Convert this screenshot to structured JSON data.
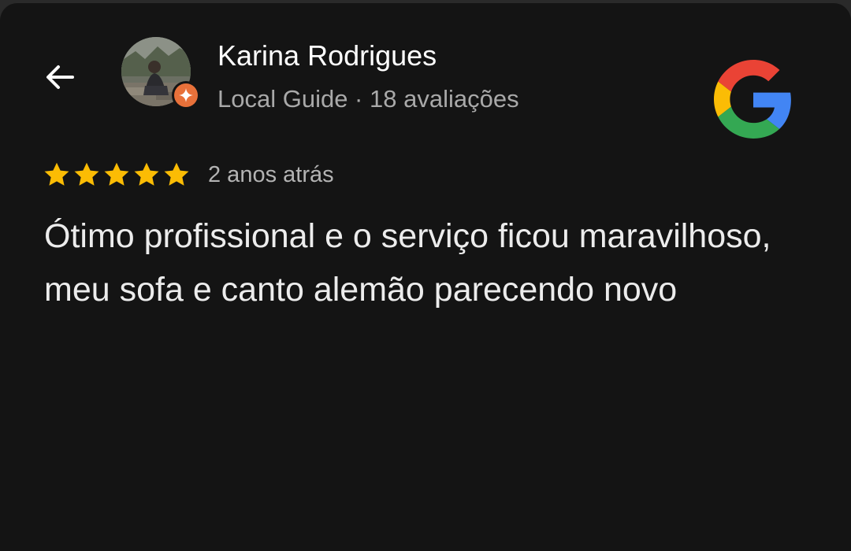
{
  "header": {
    "back_icon": "arrow-left-icon",
    "reviewer_name": "Karina Rodrigues",
    "reviewer_meta": "Local Guide · 18 avaliações",
    "badge_icon": "local-guide-star-icon",
    "brand_icon": "google-g-logo"
  },
  "review": {
    "rating": 5,
    "max_rating": 5,
    "star_color": "#fbbc04",
    "date": "2 anos atrás",
    "text": "Ótimo profissional e o serviço ficou maravilhoso, meu sofa e canto alemão parecendo novo"
  },
  "colors": {
    "background": "#141414",
    "badge": "#e8713a",
    "google_red": "#ea4335",
    "google_yellow": "#fbbc05",
    "google_green": "#34a853",
    "google_blue": "#4285f4"
  }
}
